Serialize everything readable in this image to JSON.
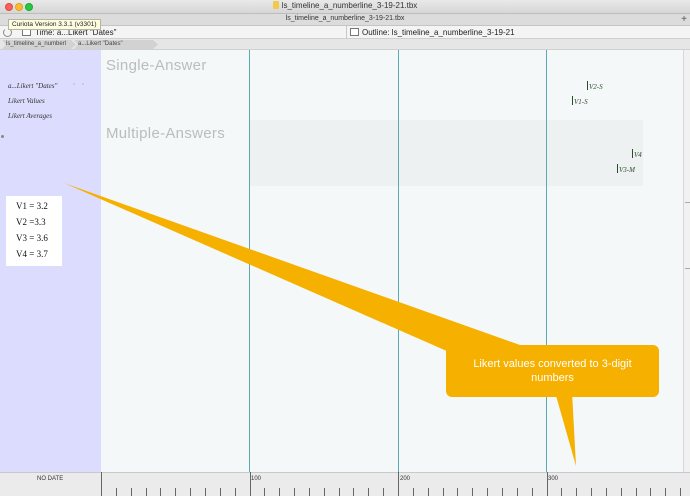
{
  "window": {
    "title": "ls_timeline_a_numberline_3-19-21.tbx",
    "tab_title": "ls_timeline_a_numberline_3-19-21.tbx",
    "tooltip": "Curiota Version 3.3.1 (v3301)",
    "traffic_lights": {
      "close": "#fc5f57",
      "minimize": "#fdbc2e",
      "zoom": "#28c840"
    }
  },
  "panes": {
    "left_title": "Time: a...Likert \"Dates\"",
    "right_title": "Outline: ls_timeline_a_numberline_3-19-21"
  },
  "breadcrumb": [
    {
      "label": "ls_timeline_a_numberl"
    },
    {
      "label": "a...Likert \"Dates\""
    }
  ],
  "sidebar": {
    "rows": [
      {
        "label": "a...Likert \"Dates\""
      },
      {
        "label": "Likert Values"
      },
      {
        "label": "Likert Averages"
      }
    ],
    "bg_color": "#dcdcff"
  },
  "annotation": {
    "lines": [
      "V1 = 3.2",
      "V2 =3.3",
      "V3 = 3.6",
      "V4 = 3.7"
    ]
  },
  "timeline": {
    "bands": [
      {
        "label": "Single-Answer"
      },
      {
        "label": "Multiple-Answers"
      }
    ],
    "markers": [
      {
        "label": "V2-S"
      },
      {
        "label": "V1-S"
      },
      {
        "label": "V4"
      },
      {
        "label": "V3-M"
      }
    ],
    "gridline_color": "#5aa9b5"
  },
  "ruler": {
    "no_date_label": "NO DATE",
    "labels": [
      "100",
      "200",
      "300"
    ]
  },
  "callout": {
    "text": "Likert values converted to 3-digit numbers",
    "color": "#f5b000"
  }
}
